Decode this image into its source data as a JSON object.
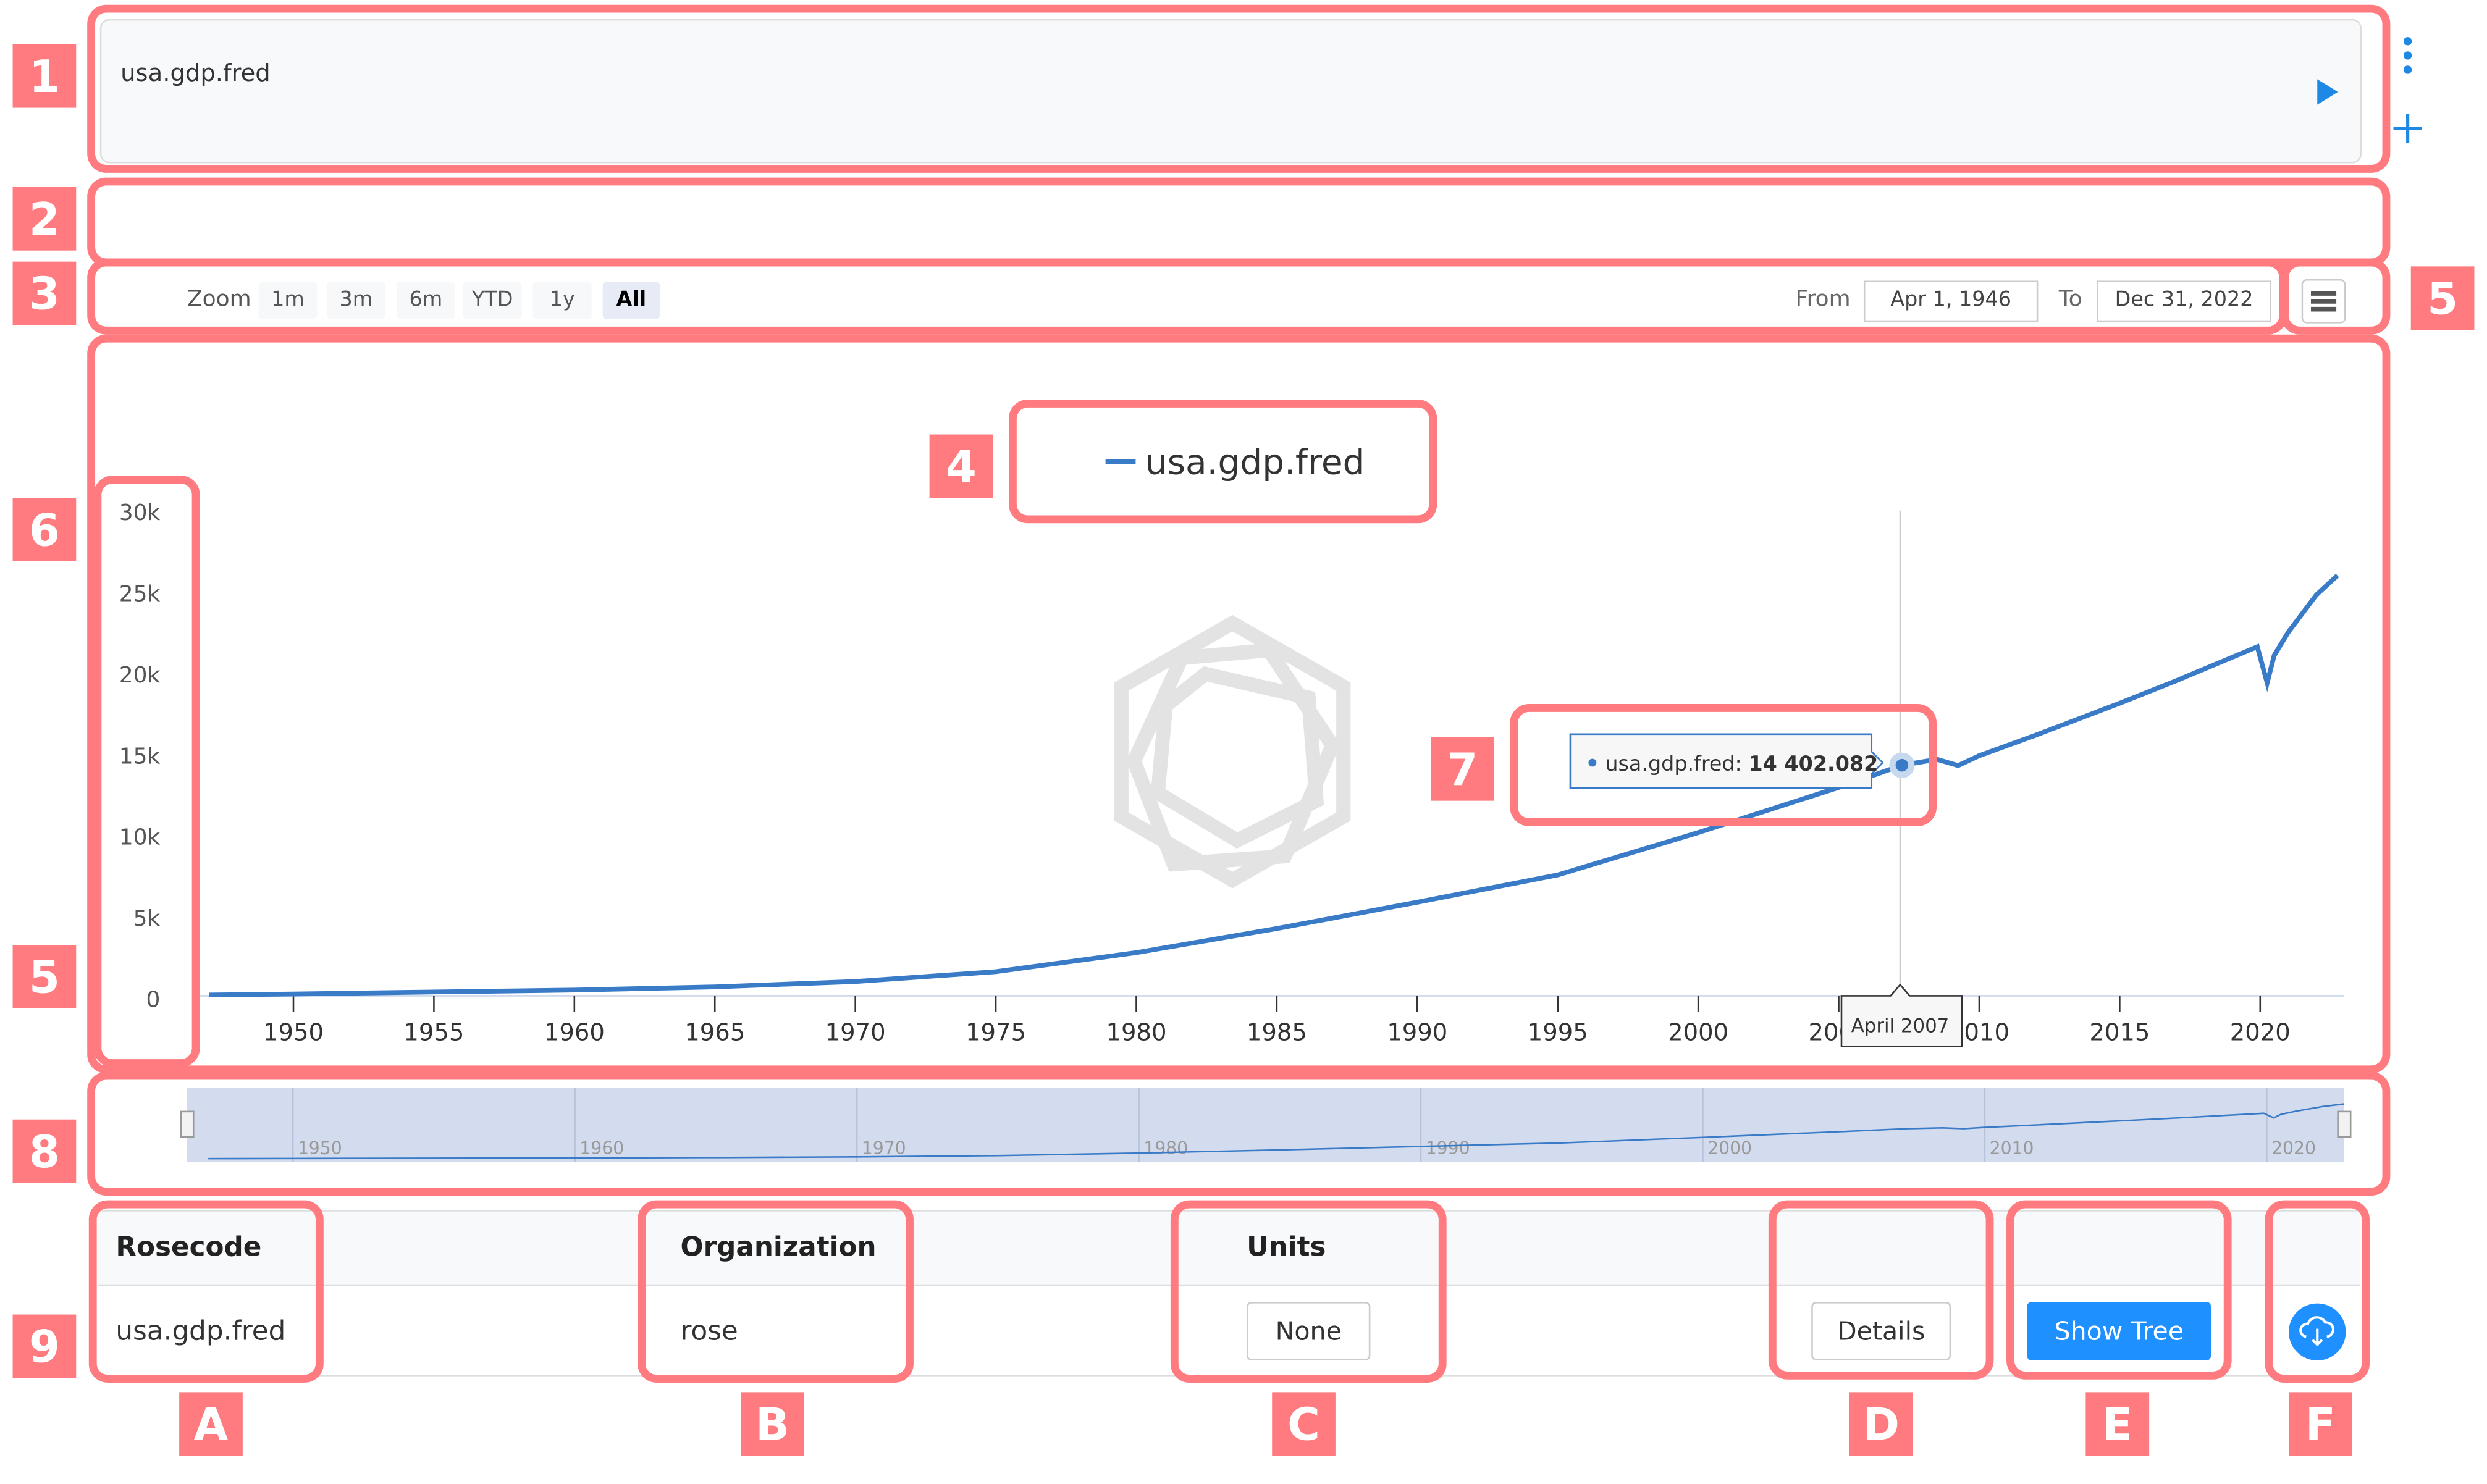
{
  "query": {
    "value": "usa.gdp.fred",
    "run_icon": "play-icon",
    "menu_icon": "vertical-dots-icon",
    "add_icon": "plus-icon"
  },
  "range_selector": {
    "zoom_label": "Zoom",
    "buttons": [
      "1m",
      "3m",
      "6m",
      "YTD",
      "1y",
      "All"
    ],
    "selected": "All",
    "from_label": "From",
    "from_value": "Apr 1, 1946",
    "to_label": "To",
    "to_value": "Dec 31, 2022",
    "export_menu_icon": "hamburger-icon"
  },
  "colors": {
    "accent": "#1e90ff",
    "series": "#3a7bc8",
    "annotation": "#ff7b7f",
    "navigator": "#d3dbee"
  },
  "chart_data": {
    "type": "line",
    "legend": "usa.gdp.fred",
    "y_ticks": [
      "0",
      "5k",
      "10k",
      "15k",
      "20k",
      "25k",
      "30k"
    ],
    "ylim": [
      0,
      30000
    ],
    "x_ticks": [
      "1950",
      "1955",
      "1960",
      "1965",
      "1970",
      "1975",
      "1980",
      "1985",
      "1990",
      "1995",
      "2000",
      "2005",
      "2010",
      "2015",
      "2020"
    ],
    "xlim": [
      1946.25,
      2022.75
    ],
    "series": [
      {
        "name": "usa.gdp.fred",
        "x": [
          1947,
          1950,
          1955,
          1960,
          1965,
          1970,
          1975,
          1980,
          1985,
          1990,
          1995,
          2000,
          2005,
          2007.25,
          2008.5,
          2009.25,
          2010,
          2012,
          2015,
          2017,
          2019.9,
          2020.25,
          2020.5,
          2021,
          2022,
          2022.75
        ],
        "y": [
          243,
          300,
          426,
          543,
          743,
          1073,
          1685,
          2857,
          4339,
          5963,
          7640,
          10250,
          13040,
          14402,
          14770,
          14380,
          14990,
          16250,
          18220,
          19600,
          21700,
          19480,
          21170,
          22600,
          24900,
          26100
        ]
      }
    ],
    "tooltip": {
      "series": "usa.gdp.fred",
      "x": 2007.25,
      "value": "14 402.082",
      "x_label": "April 2007"
    },
    "navigator_ticks": [
      "1950",
      "1960",
      "1970",
      "1980",
      "1990",
      "2000",
      "2010",
      "2020"
    ],
    "grid": false,
    "legend_position": "top-center"
  },
  "table": {
    "headers": [
      "Rosecode",
      "Organization",
      "Units"
    ],
    "row": {
      "rosecode": "usa.gdp.fred",
      "organization": "rose",
      "units": "None",
      "details": "Details",
      "show_tree": "Show Tree",
      "download_icon": "cloud-download-icon"
    }
  },
  "annotations": {
    "numbers": [
      "1",
      "2",
      "3",
      "4",
      "5",
      "6",
      "7",
      "8",
      "9"
    ],
    "letters": [
      "A",
      "B",
      "C",
      "D",
      "E",
      "F"
    ]
  }
}
